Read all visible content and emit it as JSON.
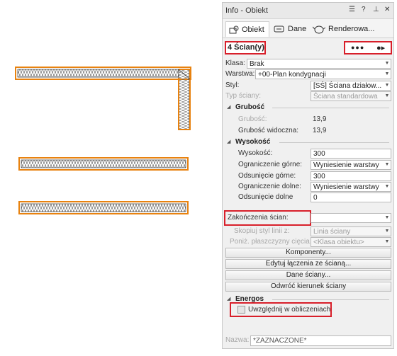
{
  "panel": {
    "title": "Info - Obiekt",
    "tabs": [
      {
        "label": "Obiekt",
        "icon": "object-icon"
      },
      {
        "label": "Dane",
        "icon": "data-icon"
      },
      {
        "label": "Renderowa...",
        "icon": "render-teapot-icon"
      }
    ],
    "selection_count": "4 Ścian(y)",
    "nav_dots": "●●●",
    "fields": {
      "klasa": {
        "label": "Klasa:",
        "value": "Brak"
      },
      "warstwa": {
        "label": "Warstwa:",
        "value": "+00-Plan kondygnacji"
      },
      "styl": {
        "label": "Styl:",
        "value": "[SŚ] Ściana działow..."
      },
      "typ": {
        "label": "Typ ściany:",
        "value": "Ściana standardowa"
      }
    },
    "grubosc": {
      "section": "Grubość",
      "grubosc_label": "Grubość:",
      "grubosc_value": "13,9",
      "widoczna_label": "Grubość widoczna:",
      "widoczna_value": "13,9"
    },
    "wysokosc": {
      "section": "Wysokość",
      "wys_label": "Wysokość:",
      "wys_value": "300",
      "ogr_g_label": "Ograniczenie górne:",
      "ogr_g_value": "Wyniesienie warstwy",
      "ods_g_label": "Odsunięcie górne:",
      "ods_g_value": "300",
      "ogr_d_label": "Ograniczenie dolne:",
      "ogr_d_value": "Wyniesienie warstwy",
      "ods_d_label": "Odsunięcie dolne",
      "ods_d_value": "0"
    },
    "zakonczenia": {
      "label": "Zakończenia ścian:",
      "value": ""
    },
    "skopiuj": {
      "label": "Skopiuj styl linii z:",
      "value": "Linia ściany"
    },
    "poniz": {
      "label": "Poniż. płaszczyzny cięcia...",
      "value": "<Klasa obiektu>"
    },
    "buttons": {
      "komponenty": "Komponenty...",
      "edytuj": "Edytuj łączenia ze ścianą...",
      "dane": "Dane ściany...",
      "odwroc": "Odwróć kierunek ściany"
    },
    "energos": {
      "section": "Energos",
      "checkbox_label": "Uwzględnij w obliczeniach",
      "checked": false
    },
    "nazwa": {
      "label": "Nazwa:",
      "value": "*ZAZNACZONE*"
    }
  },
  "colors": {
    "selection_outline": "#e8820f",
    "highlight_red": "#d81f2a"
  }
}
